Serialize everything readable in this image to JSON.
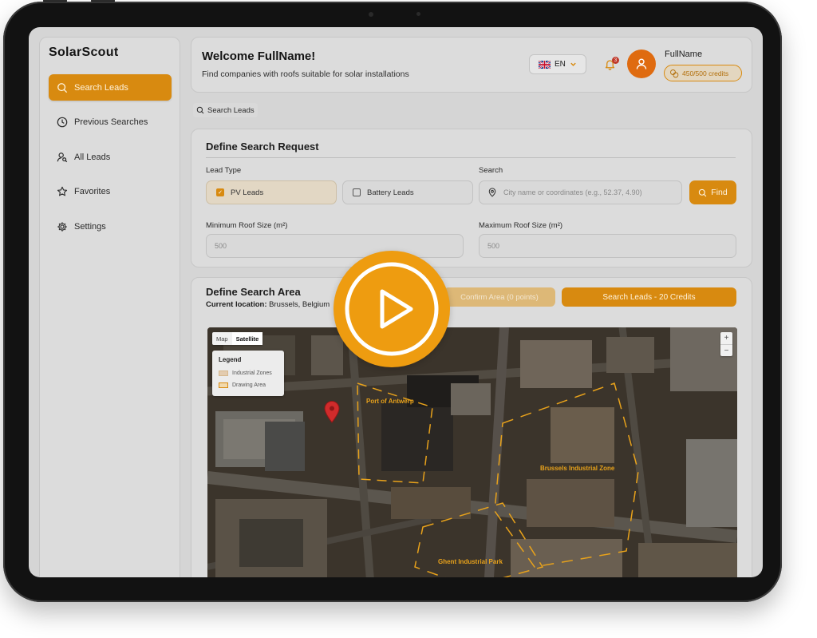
{
  "app": {
    "logo": "SolarScout"
  },
  "sidebar": {
    "items": [
      {
        "label": "Search Leads",
        "icon": "search-icon",
        "active": true
      },
      {
        "label": "Previous Searches",
        "icon": "clock-icon",
        "active": false
      },
      {
        "label": "All Leads",
        "icon": "user-search-icon",
        "active": false
      },
      {
        "label": "Favorites",
        "icon": "star-icon",
        "active": false
      },
      {
        "label": "Settings",
        "icon": "gear-icon",
        "active": false
      }
    ]
  },
  "header": {
    "welcome": "Welcome FullName!",
    "subtitle": "Find companies with roofs suitable for solar installations",
    "language": "EN",
    "language_flag": "uk-flag-icon",
    "notifications_count": "3",
    "user_name": "FullName",
    "credits": "450/500 credits"
  },
  "breadcrumb": {
    "label": "Search Leads"
  },
  "search_request": {
    "title": "Define Search Request",
    "lead_type_label": "Lead Type",
    "pv_leads_label": "PV Leads",
    "pv_leads_checked": true,
    "battery_leads_label": "Battery Leads",
    "battery_leads_checked": false,
    "search_label": "Search",
    "search_placeholder": "City name or coordinates (e.g., 52.37, 4.90)",
    "find_label": "Find",
    "min_roof_label": "Minimum Roof Size (m²)",
    "min_roof_placeholder": "500",
    "max_roof_label": "Maximum Roof Size (m²)",
    "max_roof_placeholder": "500"
  },
  "search_area": {
    "title": "Define Search Area",
    "location_label": "Current location:",
    "location_value": "Brussels, Belgium",
    "confirm_label": "Confirm Area (0 points)",
    "search_label": "Search Leads - 20 Credits"
  },
  "map": {
    "mode_map": "Map",
    "mode_satellite": "Satellite",
    "active_mode": "Satellite",
    "legend_title": "Legend",
    "legend_industrial": "Industrial Zones",
    "legend_drawing": "Drawing Area",
    "zoom_in": "+",
    "zoom_out": "−",
    "zones": [
      "Port of Antwerp",
      "Brussels Industrial Zone",
      "Ghent Industrial Park"
    ]
  },
  "colors": {
    "accent": "#d88a10",
    "play_overlay": "#ee9c10",
    "zone_label": "#e8a21b"
  },
  "overlay": {
    "icon": "play-icon"
  }
}
